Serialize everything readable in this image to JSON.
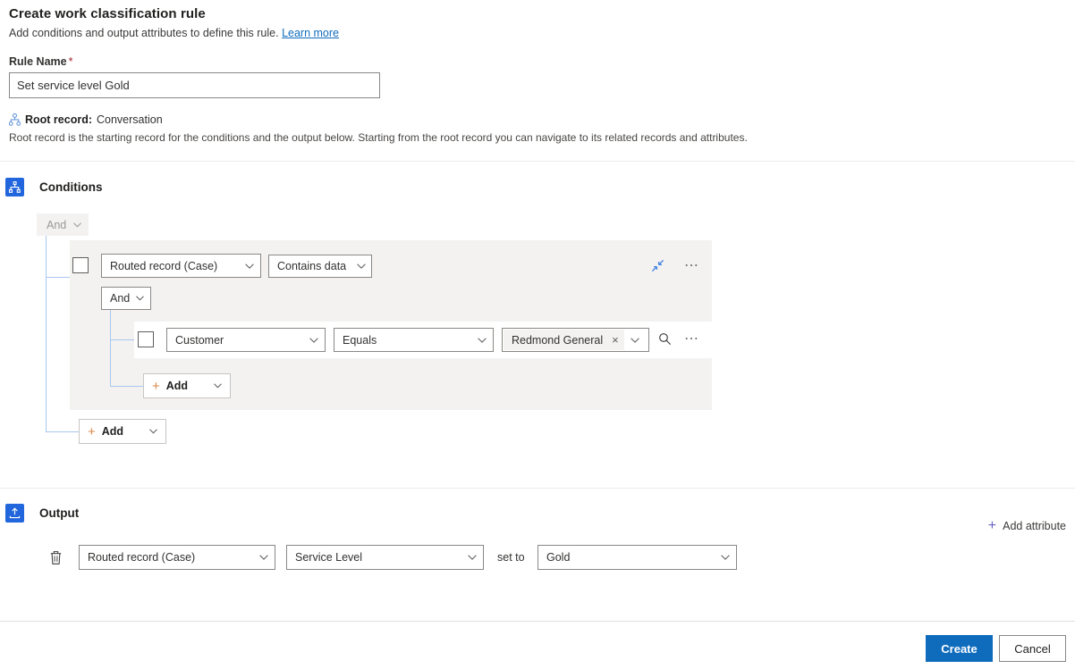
{
  "header": {
    "title": "Create work classification rule",
    "subtitle": "Add conditions and output attributes to define this rule.",
    "learn_more": "Learn more"
  },
  "rule_name": {
    "label": "Rule Name",
    "required_marker": "*",
    "value": "Set service level Gold",
    "placeholder": ""
  },
  "root_record": {
    "icon": "hierarchy-icon",
    "label": "Root record:",
    "value": "Conversation",
    "description": "Root record is the starting record for the conditions and the output below. Starting from the root record you can navigate to its related records and attributes."
  },
  "conditions": {
    "icon": "conditions-branch-icon",
    "title": "Conditions",
    "outer_operator": "And",
    "group": {
      "operator_label": "And",
      "entity": "Routed record (Case)",
      "operator": "Contains data",
      "collapse_icon": "collapse-icon",
      "overflow_icon": "ellipsis-icon",
      "inner_operator": "And",
      "inner_row": {
        "attribute": "Customer",
        "operator": "Equals",
        "value_chip": "Redmond General",
        "chip_remove": "×",
        "search_icon": "search-icon",
        "overflow_icon": "ellipsis-icon"
      },
      "inner_add": "Add"
    },
    "outer_add": "Add"
  },
  "output": {
    "icon": "output-upload-icon",
    "title": "Output",
    "add_attribute": "Add attribute",
    "add_attribute_icon": "plus-icon",
    "rows": [
      {
        "delete_icon": "trash-icon",
        "entity": "Routed record (Case)",
        "attribute": "Service Level",
        "set_to_label": "set to",
        "value": "Gold"
      }
    ]
  },
  "footer": {
    "primary": "Create",
    "secondary": "Cancel"
  },
  "colors": {
    "accent": "#0f6cbd",
    "section_icon": "#2266dd",
    "required": "#a4262c",
    "group_bg": "#f3f2f1",
    "connector": "#a7c7f0"
  }
}
